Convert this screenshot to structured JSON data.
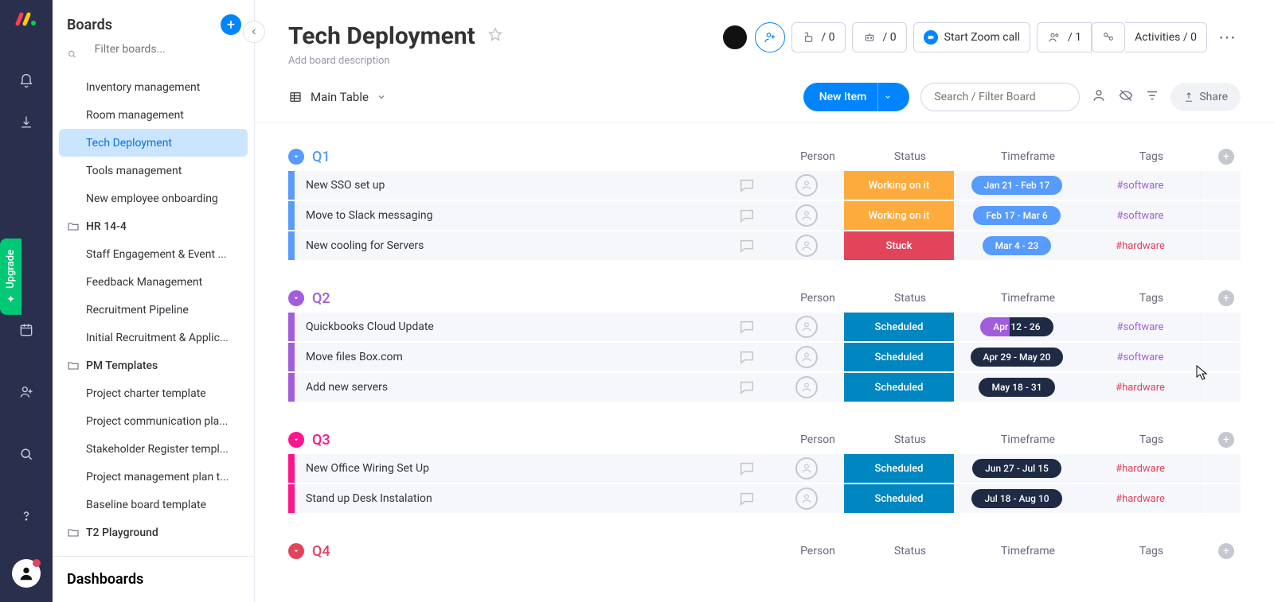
{
  "rail": {
    "upgrade": "Upgrade"
  },
  "sidebar": {
    "title": "Boards",
    "filter_placeholder": "Filter boards...",
    "dashboards": "Dashboards",
    "items": [
      {
        "type": "item",
        "label": "Inventory management"
      },
      {
        "type": "item",
        "label": "Room management"
      },
      {
        "type": "item",
        "label": "Tech Deployment",
        "active": true
      },
      {
        "type": "item",
        "label": "Tools management"
      },
      {
        "type": "item",
        "label": "New employee onboarding"
      },
      {
        "type": "folder",
        "label": "HR 14-4"
      },
      {
        "type": "item",
        "label": "Staff Engagement & Event ..."
      },
      {
        "type": "item",
        "label": "Feedback Management"
      },
      {
        "type": "item",
        "label": "Recruitment Pipeline"
      },
      {
        "type": "item",
        "label": "Initial Recruitment & Applic..."
      },
      {
        "type": "folder",
        "label": "PM Templates"
      },
      {
        "type": "item",
        "label": "Project charter template"
      },
      {
        "type": "item",
        "label": "Project communication pla..."
      },
      {
        "type": "item",
        "label": "Stakeholder Register templ..."
      },
      {
        "type": "item",
        "label": "Project management plan t..."
      },
      {
        "type": "item",
        "label": "Baseline board template"
      },
      {
        "type": "folder",
        "label": "T2 Playground"
      }
    ]
  },
  "header": {
    "title": "Tech Deployment",
    "description_placeholder": "Add board description",
    "thumbs_up": "/ 0",
    "robot": "/ 0",
    "zoom": "Start Zoom call",
    "people": "/ 1",
    "activities": "Activities / 0"
  },
  "subbar": {
    "view": "Main Table",
    "new_item": "New Item",
    "search_placeholder": "Search / Filter Board",
    "share": "Share"
  },
  "columns": {
    "person": "Person",
    "status": "Status",
    "timeframe": "Timeframe",
    "tags": "Tags"
  },
  "tag_colors": {
    "software": "#a25ddc",
    "hardware": "#e2445c"
  },
  "groups": [
    {
      "name": "Q1",
      "color": "#579bfc",
      "rows": [
        {
          "name": "New SSO set up",
          "status": "Working on it",
          "status_color": "#fdab3d",
          "time": "Jan 21 - Feb 17",
          "time_bg": "#579bfc",
          "tag": "#software",
          "tag_key": "software"
        },
        {
          "name": "Move to Slack messaging",
          "status": "Working on it",
          "status_color": "#fdab3d",
          "time": "Feb 17 - Mar 6",
          "time_bg": "#579bfc",
          "tag": "#software",
          "tag_key": "software"
        },
        {
          "name": "New cooling for Servers",
          "status": "Stuck",
          "status_color": "#e2445c",
          "time": "Mar 4 - 23",
          "time_bg": "#579bfc",
          "tag": "#hardware",
          "tag_key": "hardware"
        }
      ]
    },
    {
      "name": "Q2",
      "color": "#a25ddc",
      "rows": [
        {
          "name": "Quickbooks Cloud Update",
          "status": "Scheduled",
          "status_color": "#0086c0",
          "time": "Apr 12 - 26",
          "time_bg": "linear-gradient(90deg,#a25ddc 40%,#1f2a44 40%)",
          "tag": "#software",
          "tag_key": "software"
        },
        {
          "name": "Move files Box.com",
          "status": "Scheduled",
          "status_color": "#0086c0",
          "time": "Apr 29 - May 20",
          "time_bg": "#1f2a44",
          "tag": "#software",
          "tag_key": "software"
        },
        {
          "name": "Add new servers",
          "status": "Scheduled",
          "status_color": "#0086c0",
          "time": "May 18 - 31",
          "time_bg": "#1f2a44",
          "tag": "#hardware",
          "tag_key": "hardware"
        }
      ]
    },
    {
      "name": "Q3",
      "color": "#ff158a",
      "rows": [
        {
          "name": "New Office Wiring Set Up",
          "status": "Scheduled",
          "status_color": "#0086c0",
          "time": "Jun 27 - Jul 15",
          "time_bg": "#1f2a44",
          "tag": "#hardware",
          "tag_key": "hardware"
        },
        {
          "name": "Stand up Desk Instalation",
          "status": "Scheduled",
          "status_color": "#0086c0",
          "time": "Jul 18 - Aug 10",
          "time_bg": "#1f2a44",
          "tag": "#hardware",
          "tag_key": "hardware"
        }
      ]
    },
    {
      "name": "Q4",
      "color": "#e2445c",
      "rows": []
    }
  ]
}
